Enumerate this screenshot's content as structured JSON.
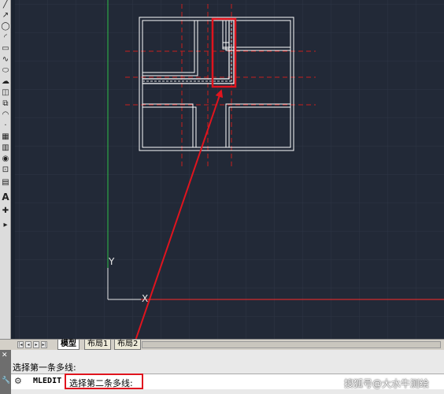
{
  "canvas": {
    "background": "#222937",
    "grid_color": "#2d3545"
  },
  "ucs": {
    "y_label": "Y",
    "x_label": "X"
  },
  "tabs": [
    {
      "label": "模型",
      "active": true
    },
    {
      "label": "布局1",
      "active": false
    },
    {
      "label": "布局2",
      "active": false
    }
  ],
  "command": {
    "history": "选择第一条多线:",
    "name": "MLEDIT",
    "prompt": "选择第二条多线:"
  },
  "watermark": "搜狐号@大水牛测绘",
  "colors": {
    "annotation": "#e0141e",
    "x_axis": "#ff2a2a",
    "y_axis": "#2fbf4a",
    "wall": "#ffffff"
  }
}
